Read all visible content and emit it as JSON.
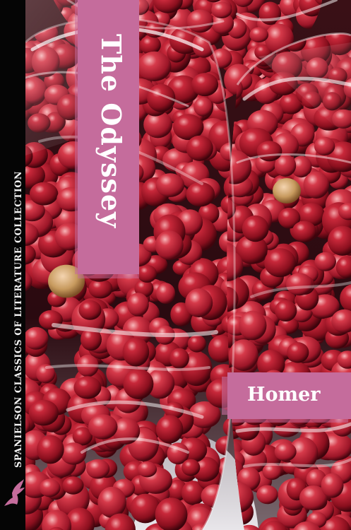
{
  "book": {
    "title": "The Odyssey",
    "author": "Homer",
    "series": "SPANIELSON CLASSICS OF LITERATURE COLLECTION"
  },
  "colors": {
    "accent": "#c56c9c",
    "spine": "#050505",
    "text": "#ffffff"
  },
  "icons": {
    "logo": "winged-angel-icon"
  }
}
